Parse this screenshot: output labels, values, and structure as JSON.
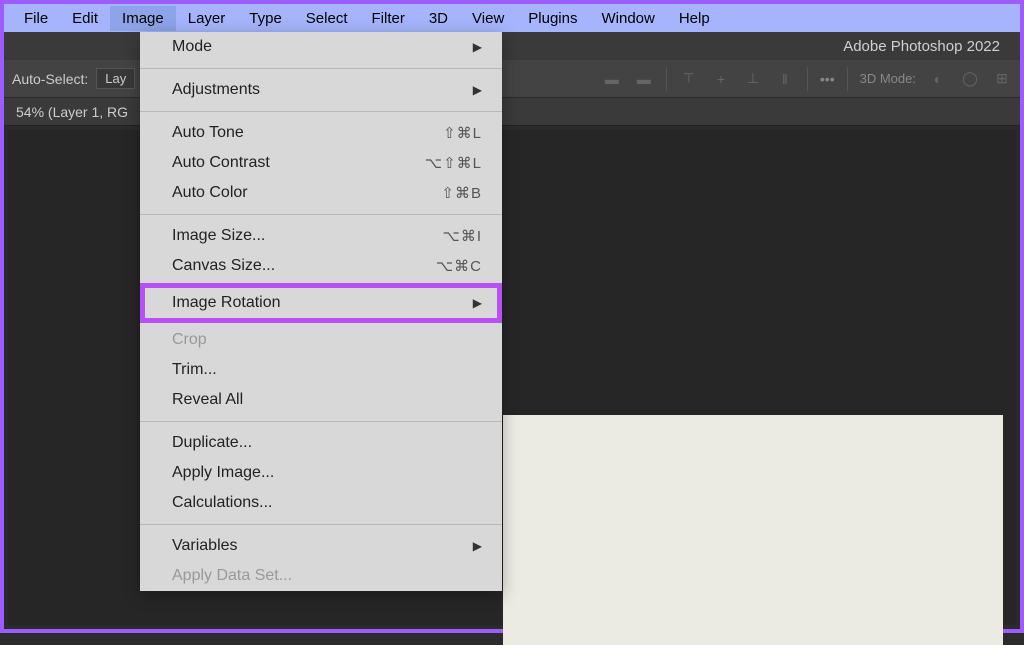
{
  "menubar": {
    "items": [
      "File",
      "Edit",
      "Image",
      "Layer",
      "Type",
      "Select",
      "Filter",
      "3D",
      "View",
      "Plugins",
      "Window",
      "Help"
    ],
    "active_index": 2
  },
  "titlebar": {
    "title": "Adobe Photoshop 2022"
  },
  "options_bar": {
    "auto_select_label": "Auto-Select:",
    "layer_dropdown": "Lay",
    "mode_3d_label": "3D Mode:",
    "more_icon": "•••"
  },
  "doc_tab": {
    "label": "54% (Layer 1, RG"
  },
  "dropdown": {
    "sections": [
      [
        {
          "label": "Mode",
          "arrow": true
        }
      ],
      [
        {
          "label": "Adjustments",
          "arrow": true
        }
      ],
      [
        {
          "label": "Auto Tone",
          "shortcut": "⇧⌘L"
        },
        {
          "label": "Auto Contrast",
          "shortcut": "⌥⇧⌘L"
        },
        {
          "label": "Auto Color",
          "shortcut": "⇧⌘B"
        }
      ],
      [
        {
          "label": "Image Size...",
          "shortcut": "⌥⌘I"
        },
        {
          "label": "Canvas Size...",
          "shortcut": "⌥⌘C"
        },
        {
          "label": "Image Rotation",
          "arrow": true,
          "highlight": true
        },
        {
          "label": "Crop",
          "disabled": true
        },
        {
          "label": "Trim..."
        },
        {
          "label": "Reveal All"
        }
      ],
      [
        {
          "label": "Duplicate..."
        },
        {
          "label": "Apply Image..."
        },
        {
          "label": "Calculations..."
        }
      ],
      [
        {
          "label": "Variables",
          "arrow": true
        },
        {
          "label": "Apply Data Set...",
          "disabled": true
        }
      ]
    ]
  }
}
